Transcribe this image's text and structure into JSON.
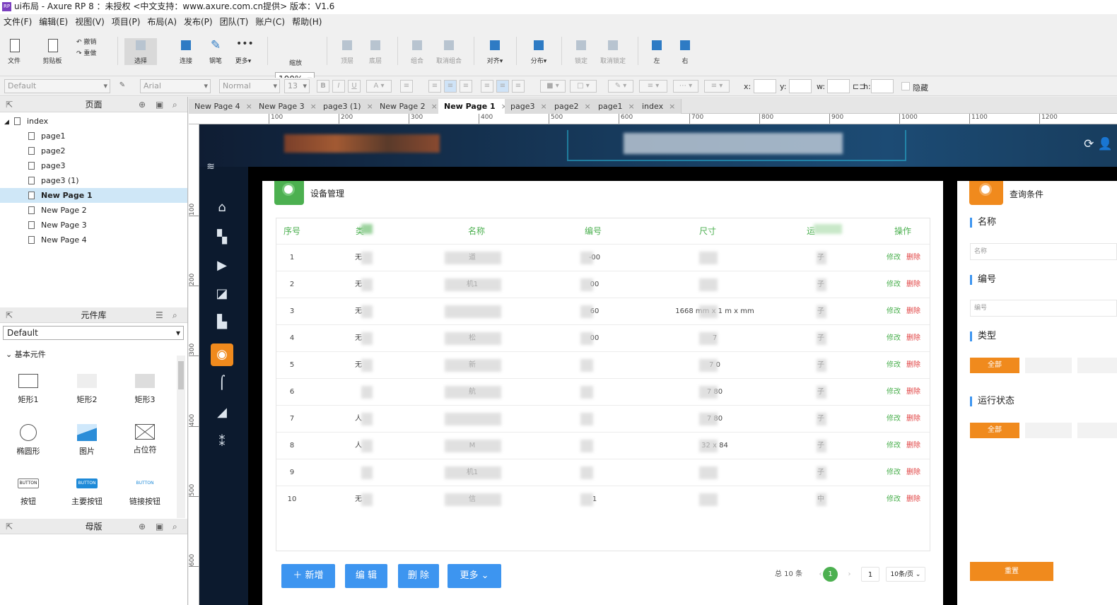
{
  "window": {
    "title": "ui布局 - Axure RP 8 ：未授权     <中文支持：www.axure.com.cn提供> 版本：V1.6",
    "app_badge": "RP"
  },
  "menu": [
    "文件(F)",
    "编辑(E)",
    "视图(V)",
    "项目(P)",
    "布局(A)",
    "发布(P)",
    "团队(T)",
    "账户(C)",
    "帮助(H)"
  ],
  "toolbar": {
    "file": "文件",
    "clipboard": "剪贴板",
    "undo": "撤销",
    "redo": "重做",
    "select": "选择",
    "connect": "连接",
    "pen": "钢笔",
    "more": "更多▾",
    "zoom_value": "100%",
    "zoom_label": "缩放",
    "top": "顶层",
    "bottom": "底层",
    "group": "组合",
    "ungroup": "取消组合",
    "align": "对齐▾",
    "distribute": "分布▾",
    "lock": "锁定",
    "unlock": "取消锁定",
    "left": "左",
    "right": "右"
  },
  "format": {
    "style": "Default",
    "font": "Arial",
    "weight": "Normal",
    "size": "13",
    "x": "x:",
    "y": "y:",
    "w": "w:",
    "h": "h:",
    "hidden": "隐藏"
  },
  "pages_panel": {
    "title": "页面",
    "root": "index",
    "pages": [
      "page1",
      "page2",
      "page3",
      "page3 (1)",
      "New Page 1",
      "New Page 2",
      "New Page 3",
      "New Page 4"
    ],
    "selected": "New Page 1"
  },
  "library_panel": {
    "title": "元件库",
    "library": "Default",
    "group": "基本元件",
    "widgets": [
      "矩形1",
      "矩形2",
      "矩形3",
      "椭圆形",
      "图片",
      "占位符",
      "按钮",
      "主要按钮",
      "链接按钮"
    ],
    "button_text": "BUTTON"
  },
  "masters_panel": {
    "title": "母版"
  },
  "tabs": [
    {
      "label": "New Page 4",
      "active": false
    },
    {
      "label": "New Page 3",
      "active": false
    },
    {
      "label": "page3 (1)",
      "active": false
    },
    {
      "label": "New Page 2",
      "active": false
    },
    {
      "label": "New Page 1",
      "active": true
    },
    {
      "label": "page3",
      "active": false
    },
    {
      "label": "page2",
      "active": false
    },
    {
      "label": "page1",
      "active": false
    },
    {
      "label": "index",
      "active": false
    }
  ],
  "ruler": {
    "h": [
      "100",
      "200",
      "300",
      "400",
      "500",
      "600",
      "700",
      "800",
      "900",
      "1000",
      "1100",
      "1200"
    ],
    "v": [
      "100",
      "200",
      "300",
      "400",
      "500",
      "600"
    ]
  },
  "app": {
    "main_title": "设备管理",
    "columns": [
      "序号",
      "类",
      "名称",
      "编号",
      "尺寸",
      "运",
      "操作"
    ],
    "rows": [
      {
        "no": "1",
        "type": "无",
        "name": "道",
        "code": "-00",
        "size": "",
        "status": "子"
      },
      {
        "no": "2",
        "type": "无",
        "name": "机1",
        "code": "00",
        "size": "",
        "status": "子"
      },
      {
        "no": "3",
        "type": "无",
        "name": "",
        "code": "60",
        "size": "1668 mm x 1      m x      mm",
        "status": "子"
      },
      {
        "no": "4",
        "type": "无",
        "name": "松",
        "code": "00",
        "size": "7",
        "status": "子"
      },
      {
        "no": "5",
        "type": "无",
        "name": "新",
        "code": "",
        "size": "7     0",
        "status": "子"
      },
      {
        "no": "6",
        "type": "",
        "name": "航",
        "code": "",
        "size": "7     80",
        "status": "子"
      },
      {
        "no": "7",
        "type": "人",
        "name": "",
        "code": "",
        "size": "7     80",
        "status": "子"
      },
      {
        "no": "8",
        "type": "人",
        "name": "M",
        "code": "",
        "size": "32       x 84",
        "status": "子"
      },
      {
        "no": "9",
        "type": "",
        "name": "机1",
        "code": "",
        "size": "",
        "status": "子"
      },
      {
        "no": "10",
        "type": "无",
        "name": "信",
        "code": "1",
        "size": "",
        "status": "中"
      }
    ],
    "op_edit": "修改",
    "op_delete": "删除",
    "buttons": {
      "add": "＋ 新增",
      "edit": "编 辑",
      "delete": "删 除",
      "more": "更多 ⌄"
    },
    "pagination": {
      "total": "总 10 条",
      "current": "1",
      "jump": "1",
      "per_page": "10条/页 ⌄"
    },
    "query": {
      "title": "查询条件",
      "name_label": "名称",
      "name_placeholder": "名称",
      "code_label": "编号",
      "code_placeholder": "编号",
      "type_label": "类型",
      "status_label": "运行状态",
      "all": "全部",
      "reset": "重置"
    }
  },
  "colors": {
    "green": "#4cb050",
    "orange": "#f08a1d",
    "blue": "#3d95f0",
    "red": "#e04040",
    "dark_nav": "#0c1a2e"
  }
}
